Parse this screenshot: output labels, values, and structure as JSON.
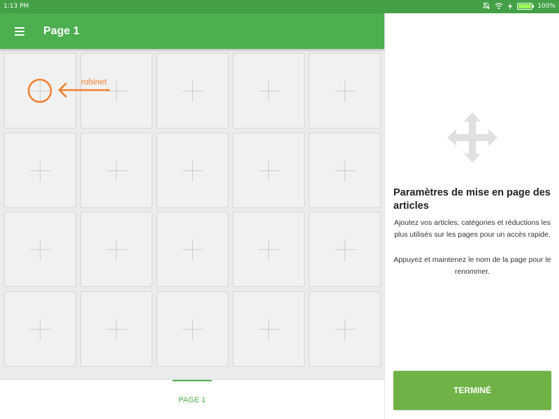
{
  "status_bar": {
    "time": "1:13 PM",
    "battery_percent": "100%",
    "icons": [
      "notifications-off-icon",
      "wifi-icon",
      "charging-icon",
      "battery-icon"
    ]
  },
  "app_bar": {
    "title": "Page 1",
    "menu_icon": "menu-icon"
  },
  "grid": {
    "rows": 4,
    "columns": 5,
    "tile_icon": "plus-icon"
  },
  "annotation": {
    "label": "robinet",
    "color": "#f07f2e"
  },
  "page_tabs": [
    {
      "label": "PAGE 1",
      "selected": true
    }
  ],
  "info_panel": {
    "icon": "move-arrows-icon",
    "heading": "Paramètres de mise en page des articles",
    "text1": "Ajoutez vos articles, catégories et réductions les plus utilisés sur les pages pour un accès rapide.",
    "text2": "Appuyez et maintenez le nom de la page pour le renommer.",
    "done_button": "TERMINÉ"
  },
  "colors": {
    "status_bar": "#43a047",
    "app_bar": "#4caf50",
    "done_button": "#6fb245",
    "annotation": "#f07f2e"
  }
}
